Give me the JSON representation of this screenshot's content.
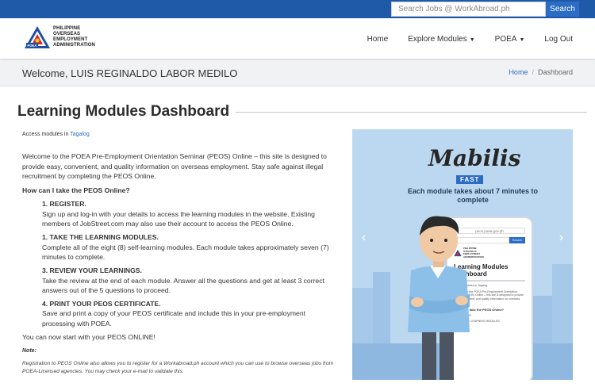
{
  "search": {
    "placeholder": "Search Jobs @ WorkAbroad.ph",
    "button_label": "Search"
  },
  "logo": {
    "lines": [
      "PHILIPPINE",
      "OVERSEAS",
      "EMPLOYMENT",
      "ADMINISTRATION"
    ],
    "badge": "POEA"
  },
  "nav": {
    "home": "Home",
    "explore": "Explore Modules",
    "poea": "POEA",
    "logout": "Log Out"
  },
  "welcome": {
    "text": "Welcome, LUIS REGINALDO LABOR MEDILO"
  },
  "breadcrumb": {
    "home": "Home",
    "separator": "/",
    "current": "Dashboard"
  },
  "page": {
    "title": "Learning Modules Dashboard"
  },
  "access": {
    "prefix": "Access modules in",
    "link": "Tagalog"
  },
  "intro": "Welcome to the POEA Pre-Employment Orientation Seminar (PEOS) Online – this site is designed to provide easy, convenient, and quality information on overseas employment. Stay safe against illegal recruitment by completing the PEOS Online.",
  "how_heading": "How can I take the PEOS Online?",
  "steps": [
    {
      "title": "1. REGISTER.",
      "text": "Sign up and log-in with your details to access the learning modules in the website. Existing members of JobStreet.com may also use their account to access the PEOS Online."
    },
    {
      "title": "1. TAKE THE LEARNING MODULES.",
      "text": "Complete all of the eight (8) self-learning modules. Each module takes approximately seven (7) minutes to complete."
    },
    {
      "title": "3. REVIEW YOUR LEARNINGS.",
      "text": "Take the review at the end of each module. Answer all the questions and get at least 3 correct answers out of the 5 questions to proceed."
    },
    {
      "title": "4. PRINT YOUR PEOS CERTIFICATE.",
      "text": "Save and print a copy of your PEOS certificate and include this in your pre-employment processing with POEA."
    }
  ],
  "start_text": "You can now start with your PEOS ONLINE!",
  "note": {
    "label": "Note:",
    "text": "Registration to PEOS Online also allows you to register for a Workabroad.ph account which you can use to browse overseas jobs from POEA-Licensed agencies. You may check your e-mail to validate this."
  },
  "carousel": {
    "brand": "Mabilis",
    "fast": "FAST",
    "tagline": "Each module takes about 7 minutes to complete",
    "prev": "‹",
    "next": "›",
    "phone": {
      "url": "peos.poea.gov.ph",
      "search": "Search",
      "title": "Learning Modules Dashboard",
      "access": "Access modules in Tagalog",
      "intro": "Welcome to the POEA Pre-Employment Orientation Seminar (PEOS) Online – this site is designed to provide easy, convenient, and quality information on overseas employment.",
      "how": "How can I take the PEOS Online?",
      "step1": "1. REGISTER.",
      "step2": "1. TAKE THE LEARNING MODULES."
    }
  },
  "colors": {
    "topbar": "#1e5aa8",
    "accent": "#2b6cc4",
    "welcome_bg": "#f1f2f4",
    "carousel_bg": "#bcd8f0"
  }
}
